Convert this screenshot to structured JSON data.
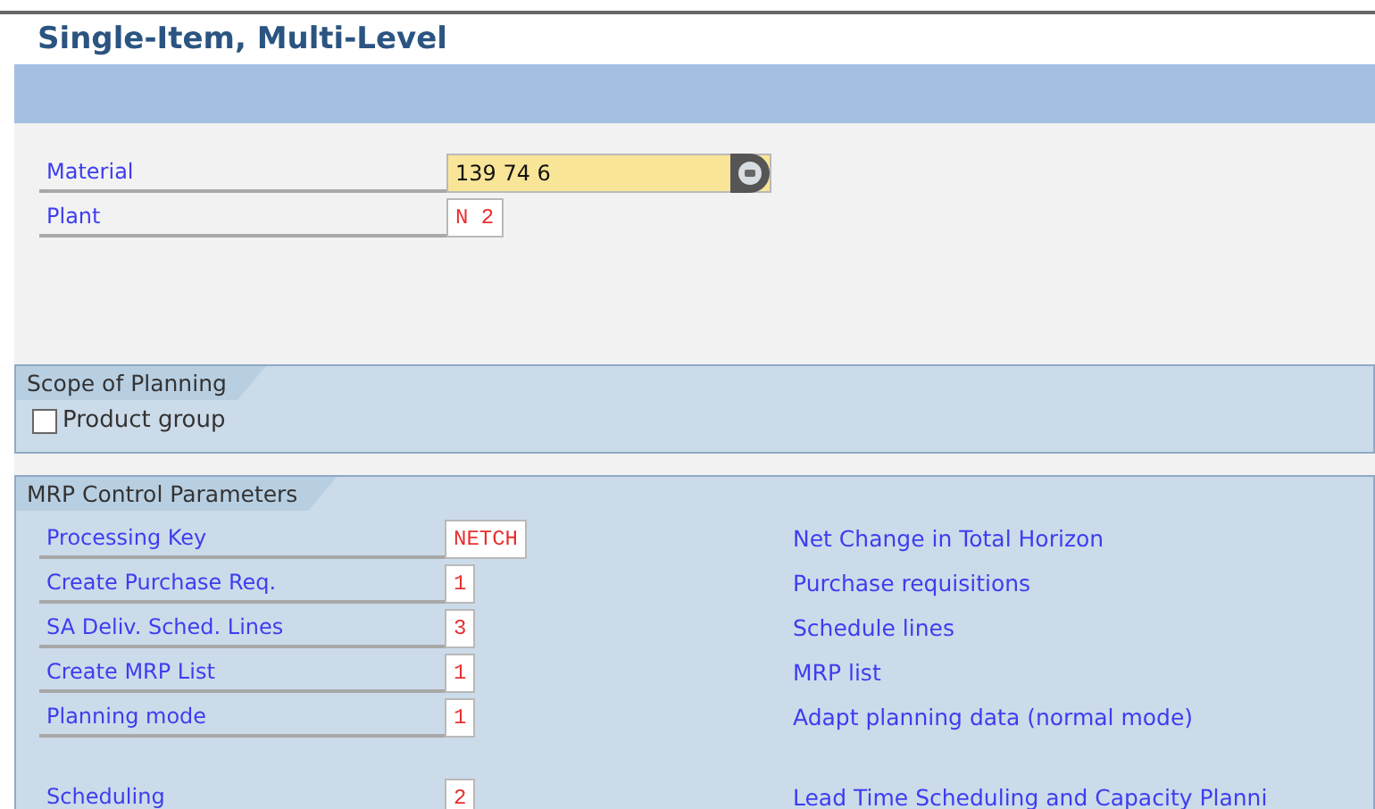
{
  "title": "Single-Item, Multi-Level",
  "header_fields": [
    {
      "label": "Material",
      "value": "139 74 6",
      "kind": "search"
    },
    {
      "label": "Plant",
      "value": "N 2",
      "kind": "plain"
    }
  ],
  "scope_group": {
    "title": "Scope of Planning",
    "checkbox": {
      "label": "Product group",
      "checked": false
    }
  },
  "mrp_group": {
    "title": "MRP Control Parameters",
    "blocks": [
      [
        {
          "label": "Processing Key",
          "value": "NETCH",
          "description": "Net Change in Total Horizon"
        },
        {
          "label": "Create Purchase Req.",
          "value": "1",
          "description": "Purchase requisitions"
        },
        {
          "label": "SA Deliv. Sched. Lines",
          "value": "3",
          "description": "Schedule lines"
        },
        {
          "label": "Create MRP List",
          "value": "1",
          "description": "MRP list"
        },
        {
          "label": "Planning mode",
          "value": "1",
          "description": "Adapt planning data (normal mode)"
        }
      ],
      [
        {
          "label": "Scheduling",
          "value": "2",
          "description": "Lead Time Scheduling and Capacity Planni"
        }
      ]
    ]
  }
}
